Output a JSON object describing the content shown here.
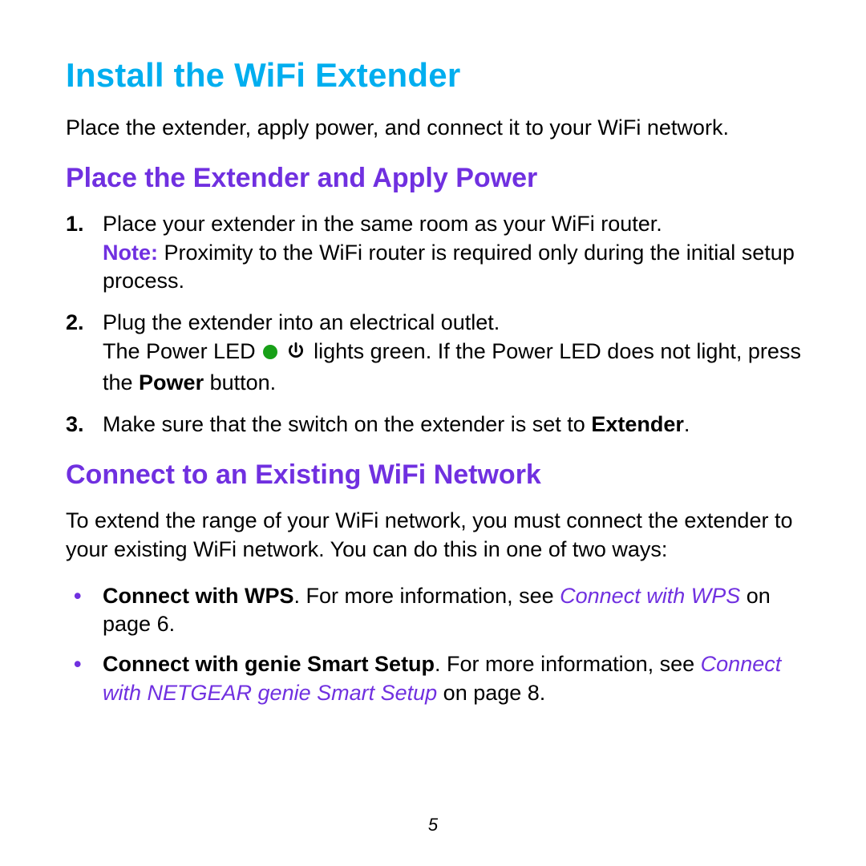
{
  "page_number": "5",
  "h1": "Install the WiFi Extender",
  "intro": "Place the extender, apply power, and connect it to your WiFi network.",
  "section1": {
    "heading": "Place the Extender and Apply Power",
    "steps": {
      "s1_line1": "Place your extender in the same room as your WiFi router.",
      "s1_note_label": "Note:",
      "s1_note_text": "  Proximity to the WiFi router is required only during the initial setup process.",
      "s2_line1": "Plug the extender into an electrical outlet.",
      "s2_led_pre": "The Power LED ",
      "s2_led_post": " lights green. If the Power LED does not light, press the ",
      "s2_power_word": "Power",
      "s2_after_power": " button.",
      "s3_pre": "Make sure that the switch on the extender is set to ",
      "s3_bold": "Extender",
      "s3_post": "."
    }
  },
  "section2": {
    "heading": "Connect to an Existing WiFi Network",
    "para": "To extend the range of your WiFi network, you must connect the extender to your existing WiFi network. You can do this in one of two ways:",
    "bullets": {
      "b1_bold": "Connect with WPS",
      "b1_mid": ". For more information, see ",
      "b1_xref": "Connect with WPS",
      "b1_tail": " on page 6.",
      "b2_bold": "Connect with genie Smart Setup",
      "b2_mid": ". For more information, see ",
      "b2_xref": "Connect with NETGEAR genie Smart Setup",
      "b2_tail": " on page 8."
    }
  },
  "icons": {
    "led_dot": "led-dot-icon",
    "power": "power-icon"
  }
}
